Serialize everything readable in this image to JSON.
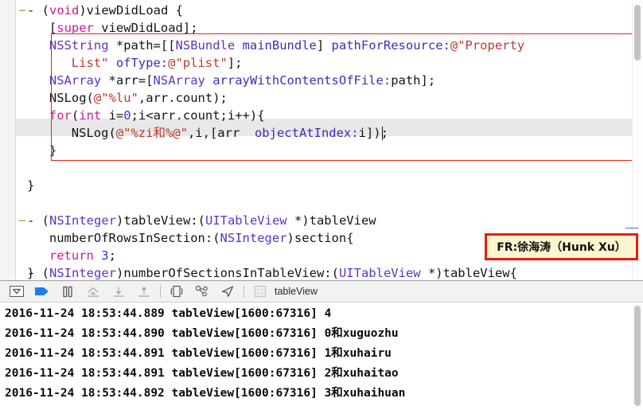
{
  "editor": {
    "lines": [
      {
        "indent": 0,
        "fold": "−",
        "tokens": [
          {
            "t": "- (",
            "c": "plain"
          },
          {
            "t": "void",
            "c": "kw"
          },
          {
            "t": ")viewDidLoad {",
            "c": "plain"
          }
        ]
      },
      {
        "indent": 1,
        "fold": "",
        "tokens": [
          {
            "t": "[",
            "c": "plain"
          },
          {
            "t": "super",
            "c": "kw spell"
          },
          {
            "t": " viewDidLoad];",
            "c": "plain"
          }
        ]
      },
      {
        "indent": 1,
        "fold": "",
        "tokens": [
          {
            "t": "NSString",
            "c": "type"
          },
          {
            "t": " *path=[[",
            "c": "plain"
          },
          {
            "t": "NSBundle",
            "c": "type"
          },
          {
            "t": " ",
            "c": "plain"
          },
          {
            "t": "mainBundle",
            "c": "msg"
          },
          {
            "t": "] ",
            "c": "plain"
          },
          {
            "t": "pathForResource:",
            "c": "msg"
          },
          {
            "t": "@\"Property",
            "c": "str"
          }
        ]
      },
      {
        "indent": 2,
        "fold": "",
        "tokens": [
          {
            "t": "List\"",
            "c": "str"
          },
          {
            "t": " ",
            "c": "plain"
          },
          {
            "t": "ofType:",
            "c": "msg"
          },
          {
            "t": "@\"plist\"",
            "c": "str"
          },
          {
            "t": "];",
            "c": "plain"
          }
        ]
      },
      {
        "indent": 1,
        "fold": "",
        "tokens": [
          {
            "t": "NSArray",
            "c": "type"
          },
          {
            "t": " *arr=[",
            "c": "plain"
          },
          {
            "t": "NSArray",
            "c": "type"
          },
          {
            "t": " ",
            "c": "plain"
          },
          {
            "t": "arrayWithContentsOfFile:",
            "c": "msg"
          },
          {
            "t": "path];",
            "c": "plain"
          }
        ]
      },
      {
        "indent": 1,
        "fold": "",
        "tokens": [
          {
            "t": "NSLog(",
            "c": "plain"
          },
          {
            "t": "@\"%lu\"",
            "c": "str"
          },
          {
            "t": ",arr.count);",
            "c": "plain"
          }
        ]
      },
      {
        "indent": 1,
        "fold": "",
        "tokens": [
          {
            "t": "for",
            "c": "kw"
          },
          {
            "t": "(",
            "c": "plain"
          },
          {
            "t": "int",
            "c": "kw"
          },
          {
            "t": " i=",
            "c": "plain"
          },
          {
            "t": "0",
            "c": "num"
          },
          {
            "t": ";i<arr.count;i++){",
            "c": "plain"
          }
        ]
      },
      {
        "indent": 2,
        "fold": "",
        "tokens": [
          {
            "t": "NSLog(",
            "c": "plain"
          },
          {
            "t": "@\"%zi和%@\"",
            "c": "str"
          },
          {
            "t": ",i,[arr  ",
            "c": "plain"
          },
          {
            "t": "objectAtIndex:",
            "c": "msg"
          },
          {
            "t": "i]);",
            "c": "plain"
          }
        ]
      },
      {
        "indent": 1,
        "fold": "",
        "tokens": [
          {
            "t": "}",
            "c": "plain"
          }
        ]
      },
      {
        "indent": 0,
        "fold": "",
        "tokens": []
      },
      {
        "indent": 0,
        "fold": "",
        "tokens": [
          {
            "t": "}",
            "c": "plain"
          }
        ]
      },
      {
        "indent": 0,
        "fold": "",
        "tokens": []
      },
      {
        "indent": 0,
        "fold": "−",
        "tokens": [
          {
            "t": "- (",
            "c": "plain"
          },
          {
            "t": "NSInteger",
            "c": "type"
          },
          {
            "t": ")tableView:(",
            "c": "plain"
          },
          {
            "t": "UITableView",
            "c": "type"
          },
          {
            "t": " *)tableView",
            "c": "plain"
          }
        ]
      },
      {
        "indent": 1,
        "fold": "",
        "tokens": [
          {
            "t": "numberOfRowsInSection:",
            "c": "plain"
          },
          {
            "t": "(",
            "c": "plain"
          },
          {
            "t": "NSInteger",
            "c": "type"
          },
          {
            "t": ")section{",
            "c": "plain"
          }
        ]
      },
      {
        "indent": 1,
        "fold": "",
        "tokens": [
          {
            "t": "return",
            "c": "kw"
          },
          {
            "t": " ",
            "c": "plain"
          },
          {
            "t": "3",
            "c": "num"
          },
          {
            "t": ";",
            "c": "plain"
          }
        ]
      },
      {
        "indent": 0,
        "fold": "",
        "tokens": [
          {
            "t": "}",
            "c": "plain"
          }
        ]
      }
    ],
    "clipped_line": [
      {
        "t": "- (",
        "c": "plain"
      },
      {
        "t": "NSInteger",
        "c": "type"
      },
      {
        "t": ")numberOfSectionsInTableView:(",
        "c": "plain"
      },
      {
        "t": "UITableView",
        "c": "type"
      },
      {
        "t": " *)tableView{",
        "c": "plain"
      }
    ]
  },
  "callout": {
    "text": "FR:徐海涛（Hunk Xu）",
    "background_color": "#fbf6cf",
    "border_color": "#e51d12"
  },
  "code_highlight_box": {
    "border_color": "#e8231a"
  },
  "toolbar": {
    "buttons": [
      {
        "name": "show-hide-navigator-button",
        "icon": "box-triangle-icon"
      },
      {
        "name": "continue-execution-button",
        "icon": "play-arrow-icon"
      },
      {
        "name": "pause-button",
        "icon": "pause-icon"
      },
      {
        "name": "step-over-button",
        "icon": "step-over-icon"
      },
      {
        "name": "step-into-button",
        "icon": "step-into-icon"
      },
      {
        "name": "step-out-button",
        "icon": "step-out-icon"
      },
      {
        "name": "view-debugging-button",
        "icon": "view-hierarchy-icon"
      },
      {
        "name": "debug-view-hierarchy-button",
        "icon": "nodes-icon"
      },
      {
        "name": "simulate-location-button",
        "icon": "location-arrow-icon"
      },
      {
        "name": "stack-frame-icon",
        "icon": "frame-grid-icon"
      }
    ],
    "scope_label": "tableView"
  },
  "console": {
    "lines": [
      "2016-11-24 18:53:44.889 tableView[1600:67316] 4",
      "2016-11-24 18:53:44.890 tableView[1600:67316] 0和xuguozhu",
      "2016-11-24 18:53:44.891 tableView[1600:67316] 1和xuhairu",
      "2016-11-24 18:53:44.891 tableView[1600:67316] 2和xuhaitao",
      "2016-11-24 18:53:44.892 tableView[1600:67316] 3和xuhaihuan"
    ]
  }
}
